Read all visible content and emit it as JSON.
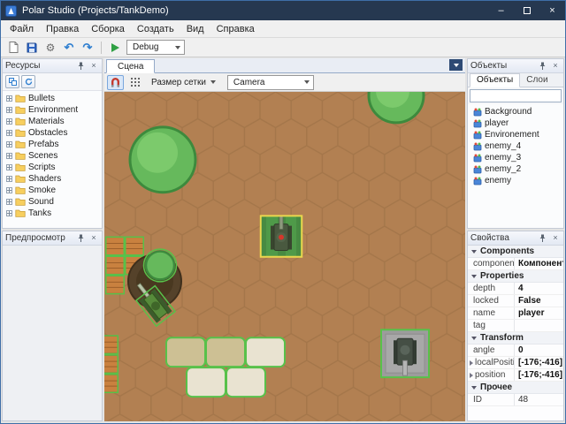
{
  "window": {
    "title": "Polar Studio (Projects/TankDemo)"
  },
  "menu": {
    "items": [
      "Файл",
      "Правка",
      "Сборка",
      "Создать",
      "Вид",
      "Справка"
    ]
  },
  "toolbar": {
    "debug_label": "Debug"
  },
  "icons": {
    "close": "×",
    "minimize": "–",
    "gear": "⚙",
    "undo": "↶",
    "redo": "↷",
    "pin": "pushpin",
    "play": "green-triangle",
    "magnet": "snap-magnet",
    "grid": "dots-grid",
    "folder": "yellow-folder",
    "game_object": "prefab-cube"
  },
  "left": {
    "resources": {
      "title": "Ресурсы",
      "items": [
        "Bullets",
        "Environment",
        "Materials",
        "Obstacles",
        "Prefabs",
        "Scenes",
        "Scripts",
        "Shaders",
        "Smoke",
        "Sound",
        "Tanks"
      ]
    },
    "preview": {
      "title": "Предпросмотр"
    }
  },
  "scene": {
    "tab": "Сцена",
    "grid_size_label": "Размер сетки",
    "camera_label": "Camera"
  },
  "right": {
    "objects": {
      "title": "Объекты",
      "tabs": [
        "Объекты",
        "Слои"
      ],
      "search_value": "",
      "items": [
        "Background",
        "player",
        "Environement",
        "enemy_4",
        "enemy_3",
        "enemy_2",
        "enemy"
      ]
    },
    "properties": {
      "title": "Свойства",
      "rows": [
        {
          "type": "group",
          "label": "Components"
        },
        {
          "type": "prop",
          "key": "component",
          "value": "Компоненты"
        },
        {
          "type": "group",
          "label": "Properties"
        },
        {
          "type": "prop",
          "key": "depth",
          "value": "4"
        },
        {
          "type": "prop",
          "key": "locked",
          "value": "False"
        },
        {
          "type": "prop",
          "key": "name",
          "value": "player"
        },
        {
          "type": "prop",
          "key": "tag",
          "value": ""
        },
        {
          "type": "group",
          "label": "Transform"
        },
        {
          "type": "prop",
          "key": "angle",
          "value": "0"
        },
        {
          "type": "prop",
          "key": "localPositi",
          "value": "[-176;-416]",
          "expand": true
        },
        {
          "type": "prop",
          "key": "position",
          "value": "[-176;-416]",
          "expand": true
        },
        {
          "type": "group",
          "label": "Прочее"
        },
        {
          "type": "prop",
          "key": "ID",
          "value": "48",
          "bold": false
        }
      ]
    }
  },
  "colors": {
    "titlebar": "#263850",
    "accent": "#2e4a74",
    "canvas-bg": "#b28052",
    "canvas-grid": "#a4764a",
    "foliage": "#66b95c",
    "foliage-light": "#7cca6c",
    "foliage-dark": "#3d8a3d",
    "selection": "#58c14a",
    "selection-active": "#ead84e",
    "crate": "#c9813f",
    "sand": "#cdc094",
    "sand-light": "#e9e3d1",
    "concrete": "#9c9c9c"
  }
}
